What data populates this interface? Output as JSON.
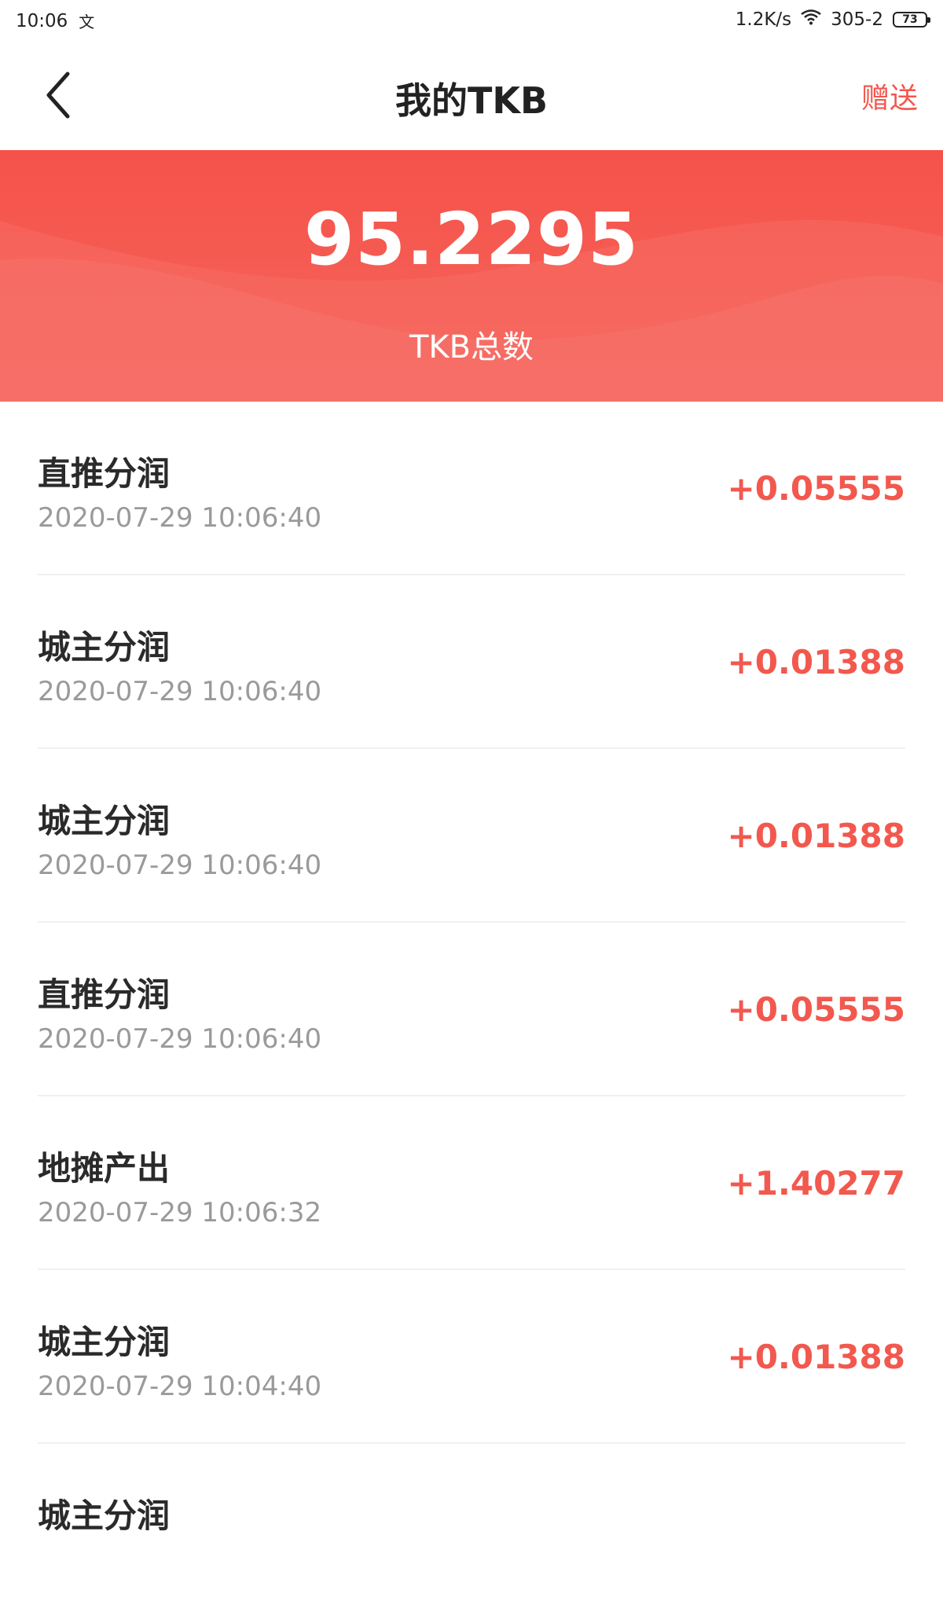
{
  "status_bar": {
    "time": "10:06",
    "notif_icon": "文",
    "net_speed": "1.2K/s",
    "wifi_icon": "wifi-icon",
    "network_name": "305-2",
    "battery": "73"
  },
  "nav": {
    "back_icon": "chevron-left-icon",
    "title": "我的TKB",
    "action": "赠送",
    "accent_color": "#f2584e"
  },
  "summary": {
    "total": "95.2295",
    "label": "TKB总数",
    "banner_color": "#f5524a"
  },
  "records": [
    {
      "title": "直推分润",
      "time": "2020-07-29 10:06:40",
      "amount": "+0.05555"
    },
    {
      "title": "城主分润",
      "time": "2020-07-29 10:06:40",
      "amount": "+0.01388"
    },
    {
      "title": "城主分润",
      "time": "2020-07-29 10:06:40",
      "amount": "+0.01388"
    },
    {
      "title": "直推分润",
      "time": "2020-07-29 10:06:40",
      "amount": "+0.05555"
    },
    {
      "title": "地摊产出",
      "time": "2020-07-29 10:06:32",
      "amount": "+1.40277"
    },
    {
      "title": "城主分润",
      "time": "2020-07-29 10:04:40",
      "amount": "+0.01388"
    },
    {
      "title": "城主分润",
      "time": "",
      "amount": ""
    }
  ]
}
